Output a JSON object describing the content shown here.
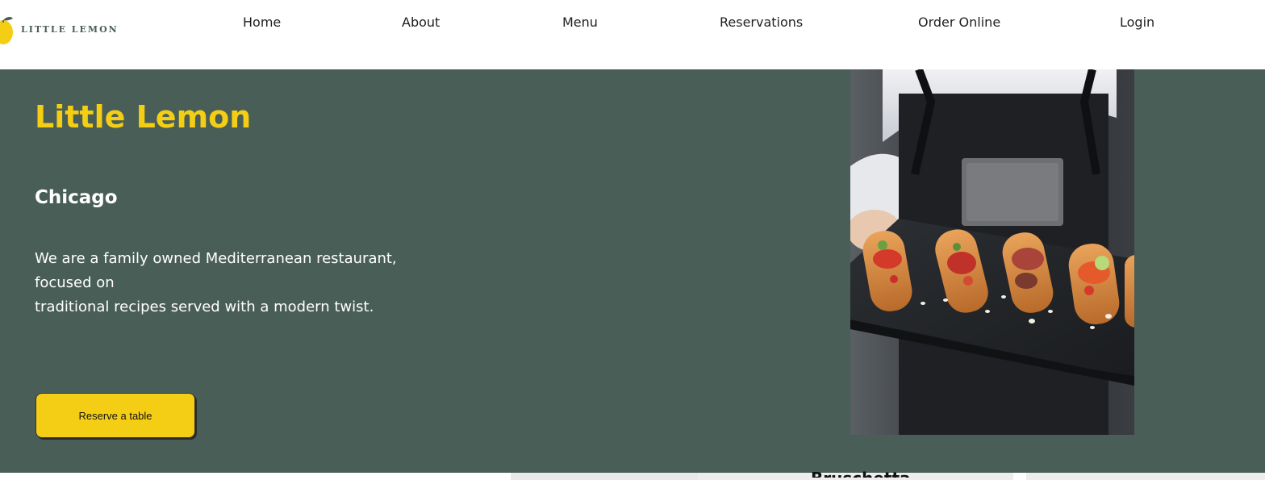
{
  "header": {
    "logo_text": "LITTLE LEMON",
    "logo_icon": "lemon-icon",
    "nav": [
      {
        "label": "Home"
      },
      {
        "label": "About"
      },
      {
        "label": "Menu"
      },
      {
        "label": "Reservations"
      },
      {
        "label": "Order Online"
      },
      {
        "label": "Login"
      }
    ]
  },
  "hero": {
    "title": "Little Lemon",
    "subtitle": "Chicago",
    "description_line1": "We are a family owned Mediterranean restaurant, focused on",
    "description_line2": "traditional recipes served with a modern twist.",
    "cta_label": "Reserve a table",
    "image_subject": "server holding slate board of bruschetta"
  },
  "below_fold": {
    "card_title_peek": "Bruschetta"
  },
  "colors": {
    "primary_green": "#495e57",
    "primary_yellow": "#f4ce14",
    "nav_text": "#1f1f1f",
    "white": "#ffffff"
  }
}
